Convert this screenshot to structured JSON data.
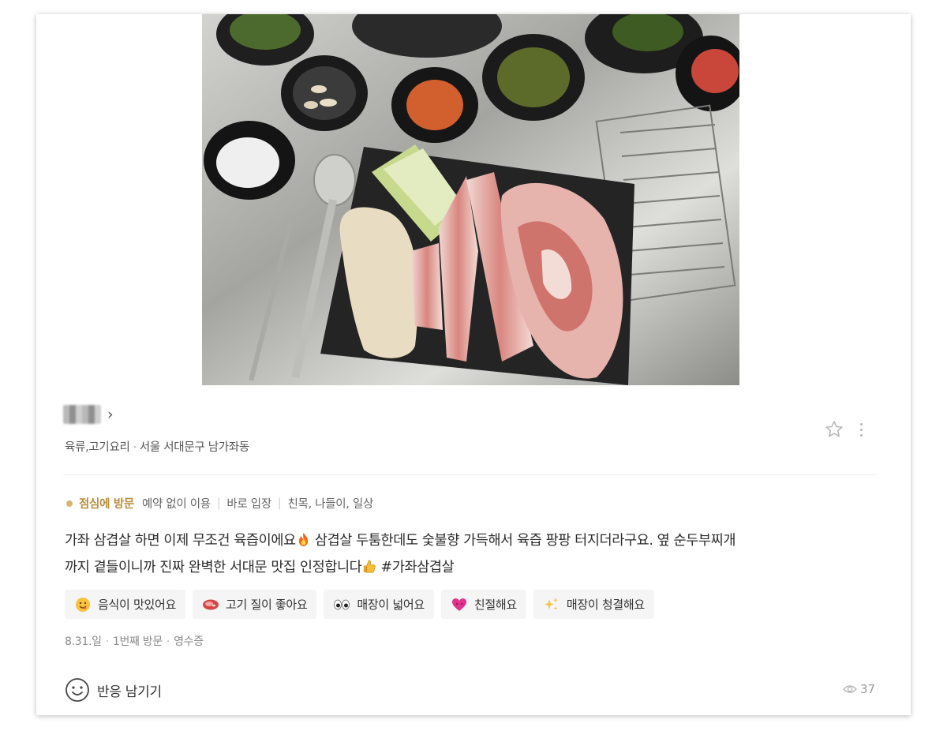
{
  "place": {
    "name": "■■■",
    "category": "육류,고기요리",
    "location": "서울 서대문구 남가좌동"
  },
  "visit": {
    "time": "점심에 방문",
    "details": [
      "예약 없이 이용",
      "바로 입장",
      "친목, 나들이, 일상"
    ]
  },
  "review": {
    "line1_a": "가좌 삼겹살 하면 이제 무조건 육즙이에요",
    "line1_b": " 삼겹살 두툼한데도 숯불향 가득해서 육즙 팡팡 터지더라구요. 옆 순두부찌개",
    "line2_a": "까지 곁들이니까 진짜 완벽한 서대문 맛집 인정합니다",
    "line2_b": " #가좌삼겹살"
  },
  "tags": [
    {
      "label": "음식이 맛있어요",
      "icon": "yum-face-icon"
    },
    {
      "label": "고기 질이 좋아요",
      "icon": "meat-icon"
    },
    {
      "label": "매장이 넓어요",
      "icon": "eyes-icon"
    },
    {
      "label": "친절해요",
      "icon": "heart-icon"
    },
    {
      "label": "매장이 청결해요",
      "icon": "sparkles-icon"
    }
  ],
  "meta": {
    "date": "8.31.일",
    "visit_count": "1번째 방문",
    "verification": "영수증"
  },
  "footer": {
    "react_label": "반응 남기기",
    "views": "37"
  },
  "colors": {
    "visit_accent": "#b88d3a",
    "tag_bg": "#f5f5f5",
    "muted": "#8a8a8a"
  }
}
